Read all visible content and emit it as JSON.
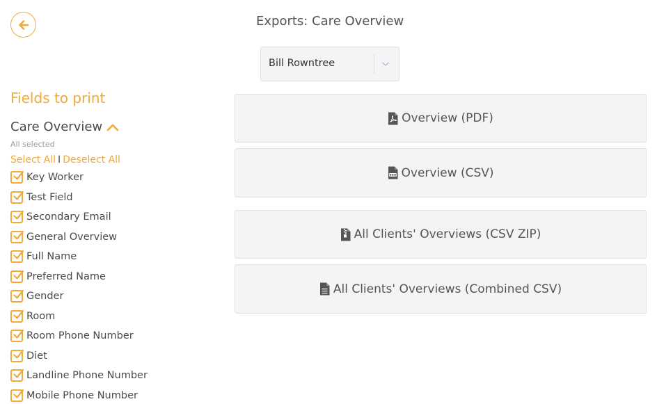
{
  "header": {
    "title": "Exports: Care Overview",
    "back_icon": "arrow-left-circle-icon"
  },
  "client_select": {
    "value": "Bill Rowntree",
    "chevron_icon": "chevron-down-icon"
  },
  "sidebar": {
    "heading": "Fields to print",
    "section_title": "Care Overview",
    "section_status": "All selected",
    "select_all": "Select All",
    "separator": "I",
    "deselect_all": "Deselect All",
    "fields": [
      {
        "label": "Key Worker",
        "checked": true
      },
      {
        "label": "Test Field",
        "checked": true
      },
      {
        "label": "Secondary Email",
        "checked": true
      },
      {
        "label": "General Overview",
        "checked": true
      },
      {
        "label": "Full Name",
        "checked": true
      },
      {
        "label": "Preferred Name",
        "checked": true
      },
      {
        "label": "Gender",
        "checked": true
      },
      {
        "label": "Room",
        "checked": true
      },
      {
        "label": "Room Phone Number",
        "checked": true
      },
      {
        "label": "Diet",
        "checked": true
      },
      {
        "label": "Landline Phone Number",
        "checked": true
      },
      {
        "label": "Mobile Phone Number",
        "checked": true
      }
    ]
  },
  "exports": [
    {
      "label": "Overview (PDF)",
      "icon": "file-pdf-icon"
    },
    {
      "label": "Overview (CSV)",
      "icon": "file-csv-icon"
    },
    {
      "label": "All Clients' Overviews (CSV ZIP)",
      "icon": "file-zip-icon"
    },
    {
      "label": "All Clients' Overviews (Combined CSV)",
      "icon": "file-icon"
    }
  ],
  "colors": {
    "accent": "#f0a93a",
    "button_bg": "#f4f3f6",
    "text": "#4a4a4a"
  }
}
